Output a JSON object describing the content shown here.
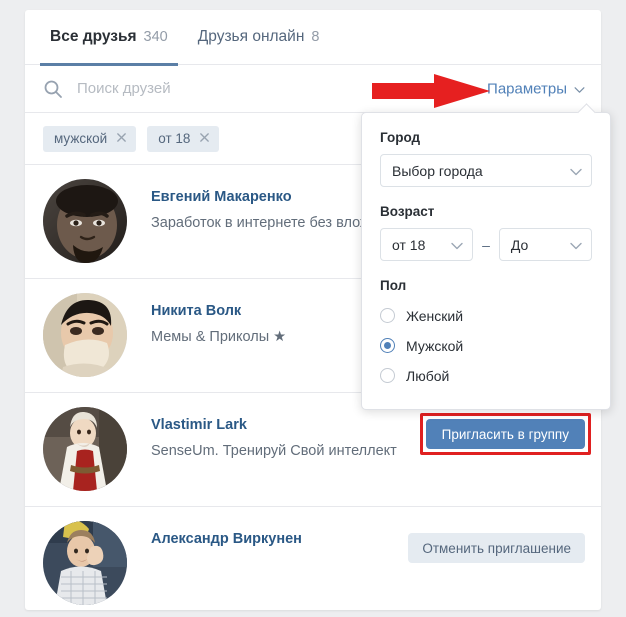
{
  "tabs": [
    {
      "label": "Все друзья",
      "count": "340",
      "active": true
    },
    {
      "label": "Друзья онлайн",
      "count": "8",
      "active": false
    }
  ],
  "search": {
    "placeholder": "Поиск друзей",
    "value": "",
    "icon": "search-icon"
  },
  "params_button": {
    "label": "Параметры",
    "icon": "chevron-down-icon"
  },
  "chips": [
    {
      "label": "мужской",
      "remove_icon": "close-icon"
    },
    {
      "label": "от 18",
      "remove_icon": "close-icon"
    }
  ],
  "dropdown": {
    "city": {
      "label": "Город",
      "select_value": "Выбор города",
      "icon": "chevron-down-icon"
    },
    "age": {
      "label": "Возраст",
      "from_value": "от 18",
      "separator": "–",
      "to_value": "До",
      "icon": "chevron-down-icon"
    },
    "gender": {
      "label": "Пол",
      "options": [
        {
          "label": "Женский",
          "selected": false
        },
        {
          "label": "Мужской",
          "selected": true
        },
        {
          "label": "Любой",
          "selected": false
        }
      ]
    }
  },
  "friends": [
    {
      "name": "Евгений Макаренко",
      "status": "Заработок в интернете без вложе",
      "action": null,
      "avatar": "avatar-photo"
    },
    {
      "name": "Никита Волк",
      "status": "Мемы & Приколы ★",
      "action": null,
      "avatar": "avatar-photo"
    },
    {
      "name": "Vlastimir Lark",
      "status": "SenseUm. Тренируй Свой интеллект",
      "action": {
        "label": "Пригласить в группу",
        "style": "primary",
        "highlighted": true
      },
      "avatar": "avatar-photo"
    },
    {
      "name": "Александр Виркунен",
      "status": "",
      "action": {
        "label": "Отменить приглашение",
        "style": "secondary",
        "highlighted": false
      },
      "avatar": "avatar-photo"
    }
  ],
  "annotation": {
    "arrow_color": "#e62020",
    "highlight_color": "#e02020"
  },
  "colors": {
    "page_bg": "#edeef0",
    "card_bg": "#ffffff",
    "link": "#2a5885",
    "accent": "#5181b8",
    "tab_underline": "#5b7fa6",
    "chip_bg": "#e5ebf1",
    "divider": "#e7e8ec"
  }
}
